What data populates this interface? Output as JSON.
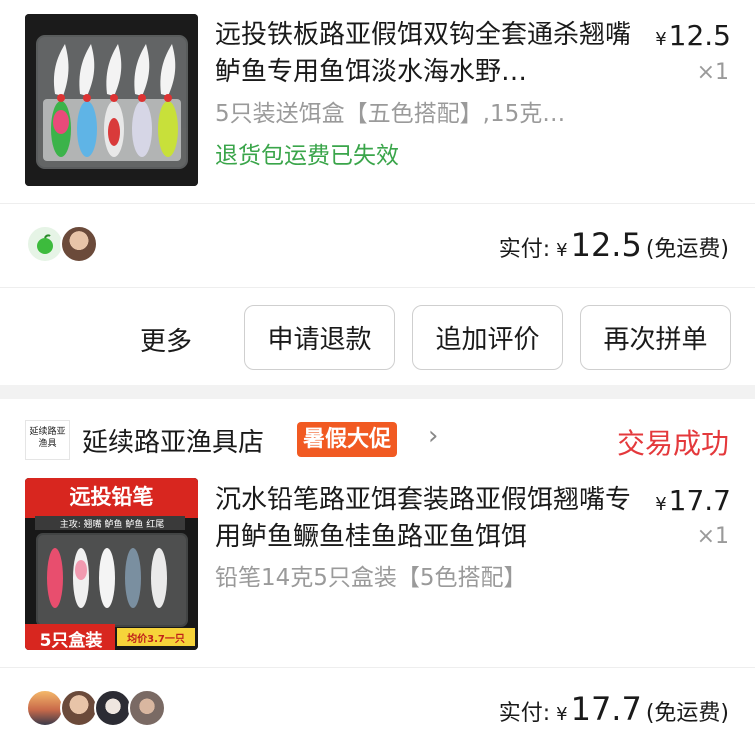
{
  "order1": {
    "product_title": "远投铁板路亚假饵双钩全套通杀翘嘴鲈鱼专用鱼饵淡水海水野…",
    "product_spec": "5只装送饵盒【五色搭配】,15克…",
    "note": "退货包运费已失效",
    "price_currency": "¥",
    "price": "12.5",
    "quantity": "×1",
    "pay_label": "实付:",
    "pay_currency": "¥",
    "pay_amount": "12.5",
    "pay_shipping": "(免运费)",
    "actions": {
      "more": "更多",
      "refund": "申请退款",
      "review": "追加评价",
      "reorder": "再次拼单"
    }
  },
  "order2": {
    "shop_logo_text": "延续路亚渔具",
    "shop_name": "延续路亚渔具店",
    "promo_badge": "暑假大促",
    "status": "交易成功",
    "thumb_banner": "远投铅笔",
    "thumb_subbanner": "主攻: 翘嘴 鲈鱼 鲈鱼 红尾",
    "thumb_badge": "5只盒装",
    "thumb_unit_price": "均价3.7一只",
    "product_title": "沉水铅笔路亚饵套装路亚假饵翘嘴专用鲈鱼鳜鱼桂鱼路亚鱼饵饵",
    "product_spec": "铅笔14克5只盒装【5色搭配】",
    "price_currency": "¥",
    "price": "17.7",
    "quantity": "×1",
    "pay_label": "实付:",
    "pay_currency": "¥",
    "pay_amount": "17.7",
    "pay_shipping": "(免运费)"
  },
  "colors": {
    "accent_red": "#e4393c",
    "promo_orange": "#f15a22",
    "note_green": "#3aa54a",
    "muted_gray": "#9a9a9a"
  }
}
